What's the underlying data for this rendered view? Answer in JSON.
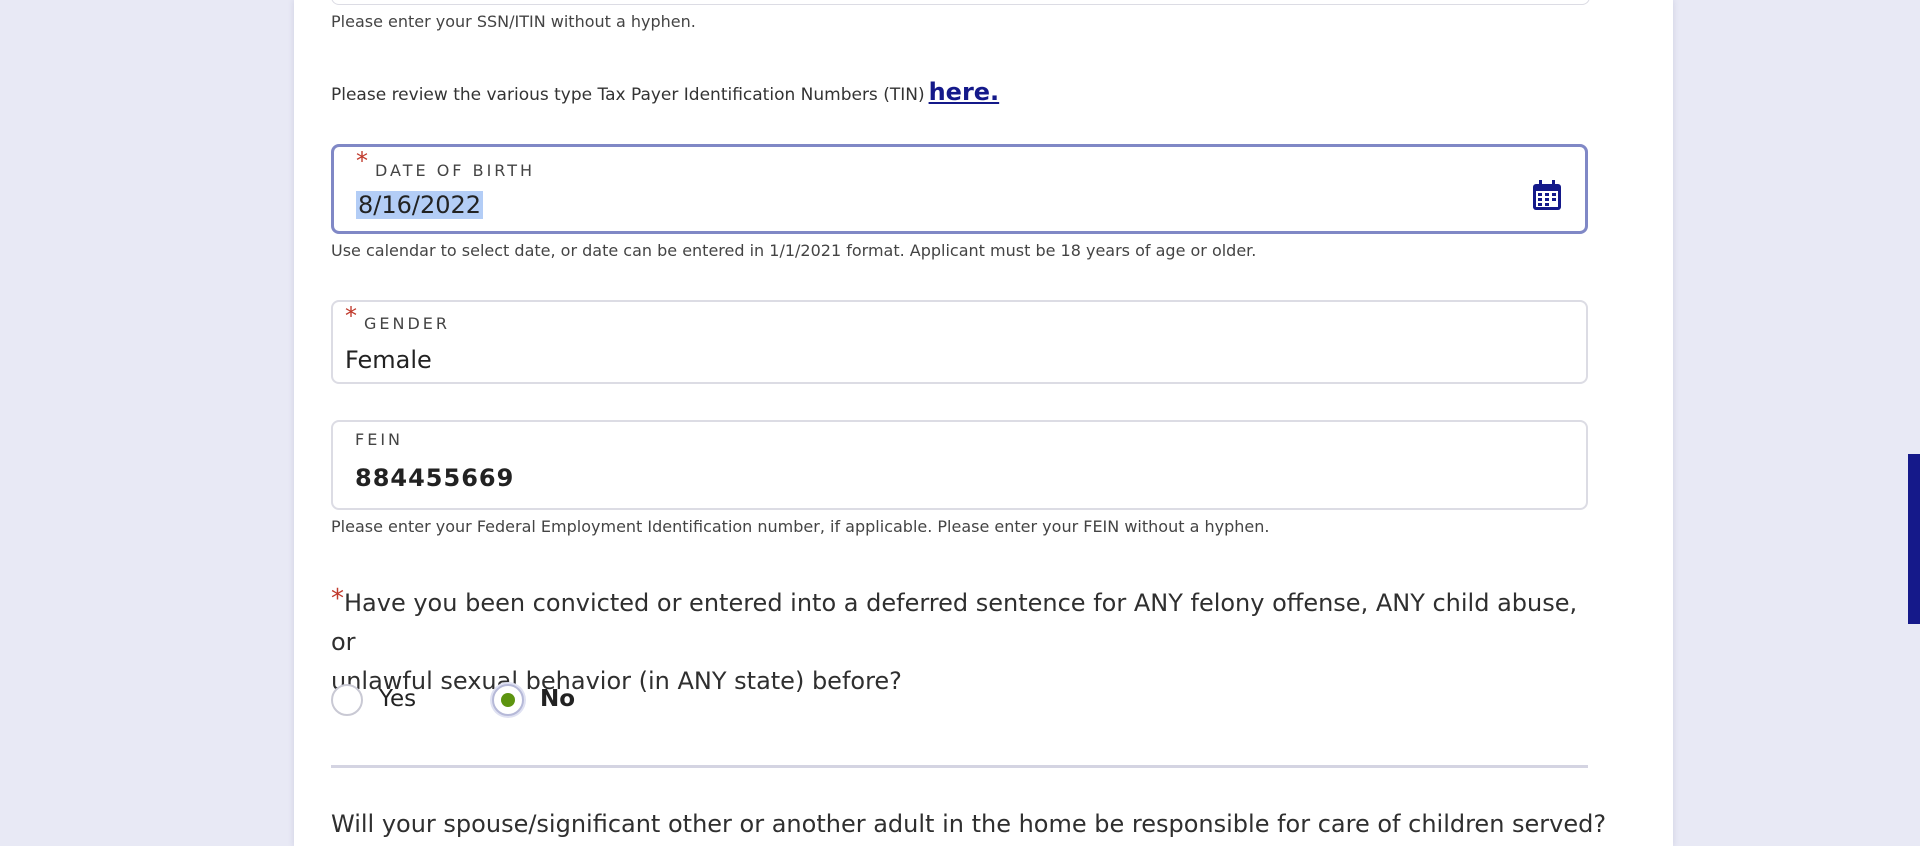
{
  "ssn_help": "Please enter your SSN/ITIN without a hyphen.",
  "tin_review": {
    "text": "Please review the various type Tax Payer Identification Numbers (TIN)",
    "link": "here."
  },
  "dob": {
    "required_mark": "*",
    "label": "DATE OF BIRTH",
    "value": "8/16/2022",
    "icon": "calendar-icon",
    "help": "Use calendar to select date, or date can be entered in 1/1/2021 format. Applicant must be 18 years of age or older."
  },
  "gender": {
    "required_mark": "*",
    "label": "GENDER",
    "value": "Female"
  },
  "fein": {
    "label": "FEIN",
    "value": "884455669",
    "help": "Please enter your Federal Employment Identification number, if applicable. Please enter your FEIN without a hyphen."
  },
  "felony_question": {
    "required_mark": "*",
    "line1": "Have you been convicted or entered into a deferred sentence for ANY felony offense, ANY child abuse, or",
    "line2": "unlawful sexual behavior (in ANY state) before?",
    "options": [
      {
        "label": "Yes",
        "checked": false
      },
      {
        "label": "No",
        "checked": true
      }
    ]
  },
  "spouse_question": "Will your spouse/significant other or another adult in the home be responsible for care of children served?",
  "colors": {
    "accent": "#14198a",
    "radio_checked": "#5d9410",
    "required": "#c0392b",
    "focus_border": "#8088c6"
  }
}
